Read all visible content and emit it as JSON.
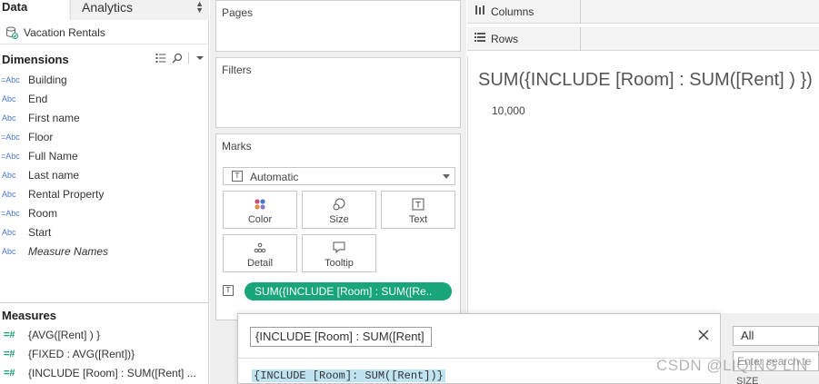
{
  "tabs": {
    "data": "Data",
    "analytics": "Analytics"
  },
  "datasource": {
    "name": "Vacation Rentals"
  },
  "dimensions": {
    "title": "Dimensions",
    "fields": [
      {
        "type": "=Abc",
        "name": "Building",
        "italic": false
      },
      {
        "type": "Abc",
        "name": "End",
        "italic": false
      },
      {
        "type": "Abc",
        "name": "First name",
        "italic": false
      },
      {
        "type": "=Abc",
        "name": "Floor",
        "italic": false
      },
      {
        "type": "=Abc",
        "name": "Full Name",
        "italic": false
      },
      {
        "type": "Abc",
        "name": "Last name",
        "italic": false
      },
      {
        "type": "Abc",
        "name": "Rental Property",
        "italic": false
      },
      {
        "type": "=Abc",
        "name": "Room",
        "italic": false
      },
      {
        "type": "Abc",
        "name": "Start",
        "italic": false
      },
      {
        "type": "Abc",
        "name": "Measure Names",
        "italic": true
      }
    ]
  },
  "measures": {
    "title": "Measures",
    "fields": [
      {
        "type": "=#",
        "name": "{AVG([Rent] ) }"
      },
      {
        "type": "=#",
        "name": "{FIXED : AVG([Rent])}"
      },
      {
        "type": "=#",
        "name": "{INCLUDE [Room] : SUM([Rent] ..."
      }
    ]
  },
  "cards": {
    "pages": "Pages",
    "filters": "Filters",
    "marks": "Marks",
    "mark_type": "Automatic",
    "buttons": {
      "color": "Color",
      "size": "Size",
      "text": "Text",
      "detail": "Detail",
      "tooltip": "Tooltip"
    },
    "pill_text": "SUM({INCLUDE [Room] : SUM([Re.."
  },
  "shelves": {
    "columns": "Columns",
    "rows": "Rows"
  },
  "view": {
    "title": "SUM({INCLUDE [Room] : SUM([Rent] ) })",
    "value": "10,000"
  },
  "calc_editor": {
    "name": "{INCLUDE [Room] : SUM([Rent]",
    "formula": "{INCLUDE [Room]: SUM([Rent])}"
  },
  "filter_pane": {
    "selected": "All",
    "search_placeholder": "Enter search te",
    "item": "SIZE"
  },
  "watermark": "CSDN @LIQING LIN",
  "colors": {
    "accent_green": "#18a57a",
    "dimension_blue": "#4a78c9",
    "measure_green": "#1a9e74",
    "formula_highlight": "#bfe3f0"
  }
}
